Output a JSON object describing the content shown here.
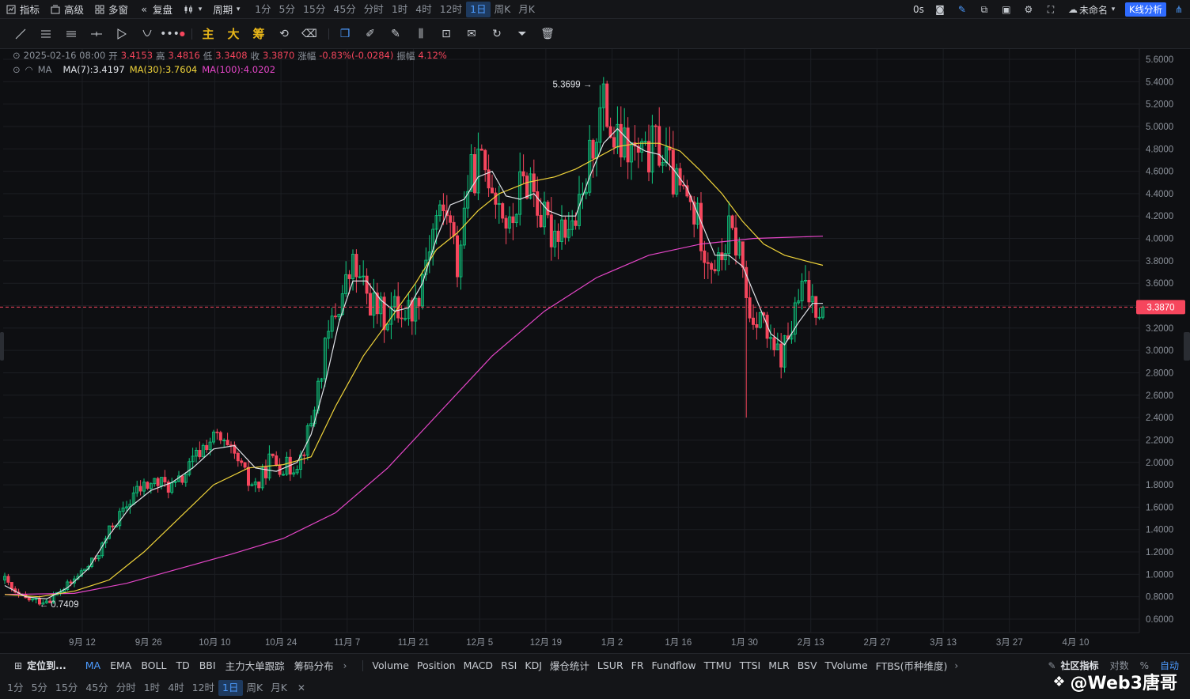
{
  "topbar": {
    "indicators": "指标",
    "advanced": "高级",
    "multi_window": "多窗",
    "replay": "复盘",
    "period": "周期",
    "timeframes": [
      "1分",
      "5分",
      "15分",
      "45分",
      "分时",
      "1时",
      "4时",
      "12时",
      "1日",
      "周K",
      "月K"
    ],
    "active_timeframe": "1日",
    "timer": "0s",
    "layout_name": "未命名",
    "kline_analysis": "K线分析"
  },
  "toolbar": {
    "gold_tools": [
      "主",
      "大",
      "筹"
    ]
  },
  "legend": {
    "date": "2025-02-16 08:00",
    "open_label": "开",
    "open": "3.4153",
    "high_label": "高",
    "high": "3.4816",
    "low_label": "低",
    "low": "3.3408",
    "close_label": "收",
    "close": "3.3870",
    "change_label": "涨幅",
    "change": "-0.83%(-0.0284)",
    "amplitude_label": "振幅",
    "amplitude": "4.12%",
    "ma_label": "MA",
    "ma7": "MA(7):3.4197",
    "ma30": "MA(30):3.7604",
    "ma100": "MA(100):4.0202"
  },
  "colors": {
    "up": "#0ecb81",
    "down": "#f6465d",
    "ma7": "#e0e3e8",
    "ma30": "#f0d43a",
    "ma100": "#e546c8",
    "accent": "#4c9bff"
  },
  "chart_data": {
    "type": "candlestick",
    "y_ticks": [
      "5.6000",
      "5.4000",
      "5.2000",
      "5.0000",
      "4.8000",
      "4.6000",
      "4.4000",
      "4.2000",
      "4.0000",
      "3.8000",
      "3.6000",
      "3.4000",
      "3.2000",
      "3.0000",
      "2.8000",
      "2.6000",
      "2.4000",
      "2.2000",
      "2.0000",
      "1.8000",
      "1.6000",
      "1.4000",
      "1.2000",
      "1.0000",
      "0.8000",
      "0.6000"
    ],
    "x_ticks": [
      "9月 12",
      "9月 26",
      "10月 10",
      "10月 24",
      "11月 7",
      "11月 21",
      "12月 5",
      "12月 19",
      "1月 2",
      "1月 16",
      "1月 30",
      "2月 13",
      "2月 27",
      "3月 13",
      "3月 27",
      "4月 10"
    ],
    "ylim": [
      0.5,
      5.7
    ],
    "current_price": "3.3870",
    "max_label": "5.3699",
    "min_label": "0.7409",
    "close_points": [
      [
        0,
        0.95
      ],
      [
        3,
        0.82
      ],
      [
        6,
        0.78
      ],
      [
        10,
        0.76
      ],
      [
        13,
        0.78
      ],
      [
        16,
        0.85
      ],
      [
        19,
        0.92
      ],
      [
        22,
        1.02
      ],
      [
        25,
        1.1
      ],
      [
        28,
        1.25
      ],
      [
        31,
        1.45
      ],
      [
        34,
        1.55
      ],
      [
        37,
        1.72
      ],
      [
        40,
        1.78
      ],
      [
        43,
        1.82
      ],
      [
        46,
        1.8
      ],
      [
        49,
        1.78
      ],
      [
        52,
        1.9
      ],
      [
        55,
        2.05
      ],
      [
        58,
        2.18
      ],
      [
        61,
        2.22
      ],
      [
        64,
        2.1
      ],
      [
        67,
        2.0
      ],
      [
        70,
        1.82
      ],
      [
        73,
        1.8
      ],
      [
        76,
        2.02
      ],
      [
        79,
        1.98
      ],
      [
        82,
        1.95
      ],
      [
        85,
        2.05
      ],
      [
        88,
        2.35
      ],
      [
        91,
        2.85
      ],
      [
        94,
        3.25
      ],
      [
        97,
        3.5
      ],
      [
        100,
        3.75
      ],
      [
        103,
        3.55
      ],
      [
        106,
        3.4
      ],
      [
        109,
        3.3
      ],
      [
        112,
        3.38
      ],
      [
        115,
        3.35
      ],
      [
        118,
        3.4
      ],
      [
        121,
        3.85
      ],
      [
        124,
        4.2
      ],
      [
        127,
        4.25
      ],
      [
        130,
        3.75
      ],
      [
        133,
        4.5
      ],
      [
        136,
        4.65
      ],
      [
        139,
        4.6
      ],
      [
        142,
        4.35
      ],
      [
        145,
        4.05
      ],
      [
        148,
        4.45
      ],
      [
        151,
        4.55
      ],
      [
        154,
        4.2
      ],
      [
        157,
        4.05
      ],
      [
        160,
        4.15
      ],
      [
        163,
        4.1
      ],
      [
        166,
        4.3
      ],
      [
        169,
        4.9
      ],
      [
        172,
        5.2
      ],
      [
        175,
        4.85
      ],
      [
        178,
        4.8
      ],
      [
        181,
        4.75
      ],
      [
        184,
        4.7
      ],
      [
        187,
        4.85
      ],
      [
        190,
        4.7
      ],
      [
        193,
        4.45
      ],
      [
        196,
        4.35
      ],
      [
        199,
        4.15
      ],
      [
        202,
        3.85
      ],
      [
        205,
        3.75
      ],
      [
        208,
        4.05
      ],
      [
        211,
        3.9
      ],
      [
        214,
        3.3
      ],
      [
        217,
        3.35
      ],
      [
        220,
        3.0
      ],
      [
        223,
        2.95
      ],
      [
        226,
        3.2
      ],
      [
        229,
        3.55
      ],
      [
        232,
        3.45
      ],
      [
        235,
        3.39
      ]
    ],
    "ma7_points": [
      [
        0,
        0.9
      ],
      [
        6,
        0.8
      ],
      [
        12,
        0.78
      ],
      [
        18,
        0.88
      ],
      [
        24,
        1.05
      ],
      [
        30,
        1.35
      ],
      [
        36,
        1.6
      ],
      [
        42,
        1.75
      ],
      [
        48,
        1.82
      ],
      [
        54,
        1.95
      ],
      [
        60,
        2.12
      ],
      [
        66,
        2.15
      ],
      [
        72,
        1.95
      ],
      [
        78,
        1.92
      ],
      [
        84,
        2.0
      ],
      [
        88,
        2.25
      ],
      [
        92,
        2.7
      ],
      [
        96,
        3.25
      ],
      [
        100,
        3.62
      ],
      [
        104,
        3.62
      ],
      [
        108,
        3.45
      ],
      [
        112,
        3.35
      ],
      [
        116,
        3.38
      ],
      [
        120,
        3.6
      ],
      [
        124,
        4.0
      ],
      [
        128,
        4.3
      ],
      [
        132,
        4.35
      ],
      [
        136,
        4.55
      ],
      [
        140,
        4.6
      ],
      [
        144,
        4.38
      ],
      [
        148,
        4.35
      ],
      [
        152,
        4.4
      ],
      [
        156,
        4.25
      ],
      [
        160,
        4.2
      ],
      [
        164,
        4.2
      ],
      [
        168,
        4.55
      ],
      [
        172,
        4.85
      ],
      [
        176,
        4.98
      ],
      [
        180,
        4.85
      ],
      [
        184,
        4.78
      ],
      [
        188,
        4.75
      ],
      [
        192,
        4.62
      ],
      [
        196,
        4.45
      ],
      [
        200,
        4.15
      ],
      [
        204,
        3.85
      ],
      [
        208,
        3.85
      ],
      [
        212,
        3.75
      ],
      [
        216,
        3.45
      ],
      [
        220,
        3.15
      ],
      [
        224,
        3.05
      ],
      [
        228,
        3.25
      ],
      [
        232,
        3.42
      ],
      [
        235,
        3.42
      ]
    ],
    "ma30_points": [
      [
        0,
        0.82
      ],
      [
        10,
        0.8
      ],
      [
        20,
        0.85
      ],
      [
        30,
        0.95
      ],
      [
        40,
        1.2
      ],
      [
        50,
        1.5
      ],
      [
        60,
        1.8
      ],
      [
        70,
        1.95
      ],
      [
        80,
        1.98
      ],
      [
        88,
        2.05
      ],
      [
        95,
        2.5
      ],
      [
        103,
        2.95
      ],
      [
        110,
        3.25
      ],
      [
        118,
        3.6
      ],
      [
        124,
        3.9
      ],
      [
        130,
        4.05
      ],
      [
        136,
        4.25
      ],
      [
        142,
        4.4
      ],
      [
        150,
        4.5
      ],
      [
        158,
        4.55
      ],
      [
        164,
        4.62
      ],
      [
        170,
        4.72
      ],
      [
        176,
        4.82
      ],
      [
        182,
        4.85
      ],
      [
        188,
        4.85
      ],
      [
        194,
        4.78
      ],
      [
        200,
        4.6
      ],
      [
        206,
        4.4
      ],
      [
        212,
        4.15
      ],
      [
        218,
        3.95
      ],
      [
        224,
        3.85
      ],
      [
        230,
        3.8
      ],
      [
        235,
        3.76
      ]
    ],
    "ma100_points": [
      [
        0,
        0.82
      ],
      [
        20,
        0.83
      ],
      [
        35,
        0.92
      ],
      [
        50,
        1.05
      ],
      [
        65,
        1.18
      ],
      [
        80,
        1.32
      ],
      [
        95,
        1.55
      ],
      [
        110,
        1.95
      ],
      [
        125,
        2.45
      ],
      [
        140,
        2.95
      ],
      [
        155,
        3.35
      ],
      [
        170,
        3.65
      ],
      [
        185,
        3.85
      ],
      [
        200,
        3.95
      ],
      [
        215,
        4.0
      ],
      [
        225,
        4.01
      ],
      [
        235,
        4.02
      ]
    ]
  },
  "indicator_bar": {
    "locate": "定位到...",
    "main_indicators": [
      "MA",
      "EMA",
      "BOLL",
      "TD",
      "BBI",
      "主力大单跟踪",
      "筹码分布"
    ],
    "active_main": "MA",
    "sub_indicators": [
      "Volume",
      "Position",
      "MACD",
      "RSI",
      "KDJ",
      "爆仓统计",
      "LSUR",
      "FR",
      "Fundflow",
      "TTMU",
      "TTSI",
      "MLR",
      "BSV",
      "TVolume",
      "FTBS(币种维度)"
    ],
    "community": "社区指标",
    "log_scale": "对数",
    "percent": "%",
    "auto": "自动",
    "watermark": "@Web3唐哥"
  }
}
